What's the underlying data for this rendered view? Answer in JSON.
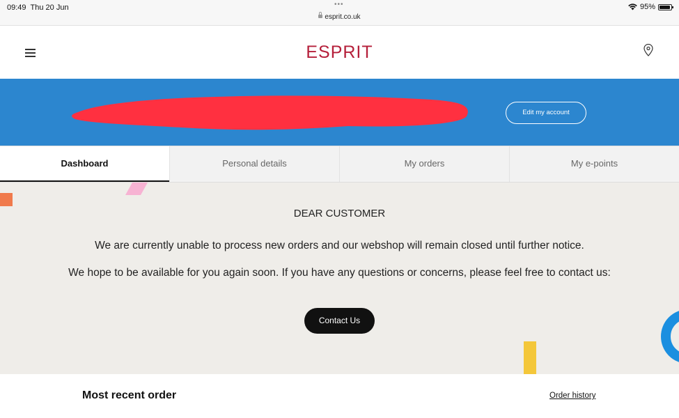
{
  "status_bar": {
    "time": "09:49",
    "date": "Thu 20 Jun",
    "url": "esprit.co.uk",
    "battery": "95%",
    "wifi_icon": "wifi-icon",
    "battery_icon": "battery-icon"
  },
  "header": {
    "logo": "ESPRIT",
    "menu_icon": "hamburger-menu-icon",
    "store_icon": "map-pin-icon",
    "brand_color": "#b51f3a"
  },
  "account_banner": {
    "edit_label": "Edit my account",
    "background_color": "#2c86cf",
    "redaction_color": "#ff3040"
  },
  "tabs": [
    {
      "label": "Dashboard",
      "active": true
    },
    {
      "label": "Personal details",
      "active": false
    },
    {
      "label": "My orders",
      "active": false
    },
    {
      "label": "My e-points",
      "active": false
    }
  ],
  "notice": {
    "title": "DEAR CUSTOMER",
    "line1": "We are currently unable to process new orders and our webshop will remain closed until further notice.",
    "line2": "We hope to be available for you again soon. If you have any questions or concerns, please feel free to contact us:",
    "contact_label": "Contact Us"
  },
  "recent_order": {
    "title": "Most recent order",
    "history_link": "Order history"
  }
}
